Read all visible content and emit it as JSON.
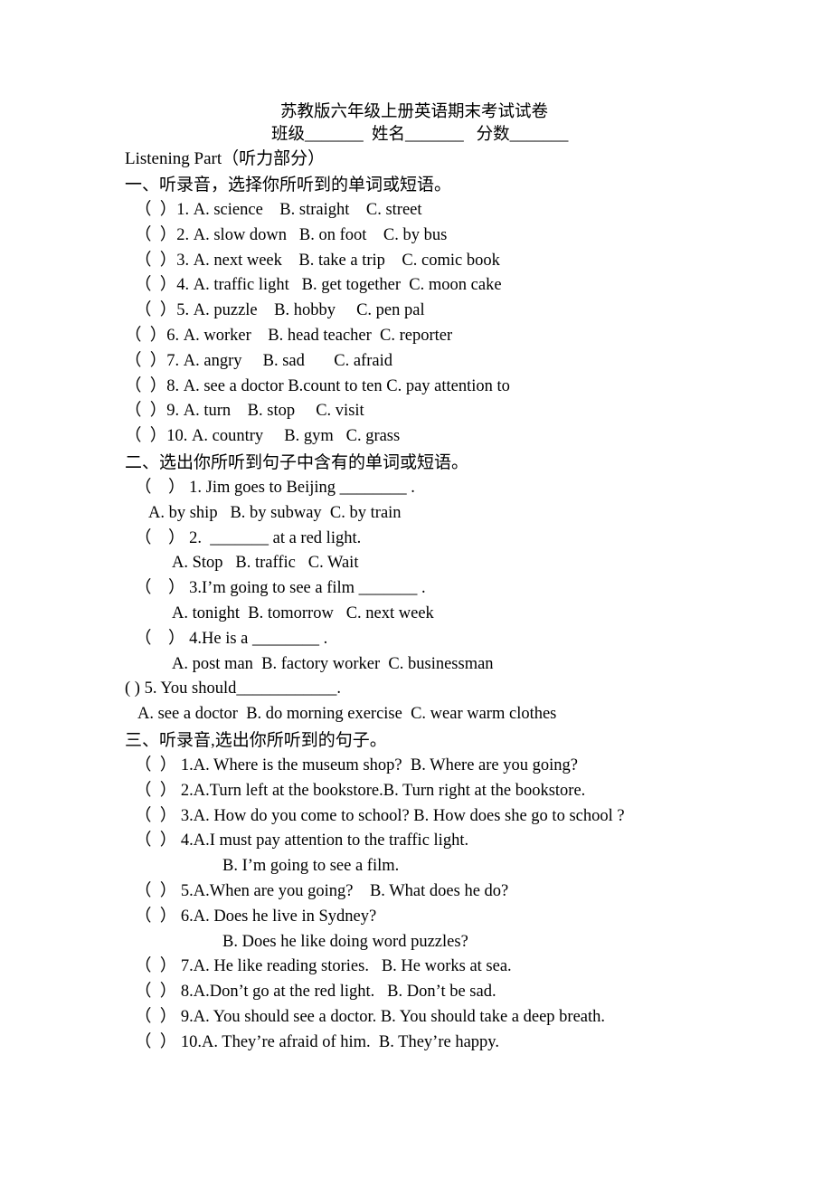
{
  "document": {
    "title": "苏教版六年级上册英语期末考试试卷",
    "id_line": "班级_______  姓名_______   分数_______",
    "part_label": "Listening Part（听力部分）"
  },
  "section_one": {
    "heading": "一、听录音，选择你所听到的单词或短语。",
    "items": [
      "（  ）1. A. science    B. straight    C. street",
      "（  ）2. A. slow down   B. on foot    C. by bus",
      "（  ）3. A. next week    B. take a trip    C. comic book",
      "（  ）4. A. traffic light   B. get together  C. moon cake",
      "（  ）5. A. puzzle    B. hobby     C. pen pal",
      "（  ）6. A. worker    B. head teacher  C. reporter",
      "（  ）7. A. angry     B. sad       C. afraid",
      "（  ）8. A. see a doctor B.count to ten C. pay attention to",
      "（  ）9. A. turn    B. stop     C. visit",
      "（  ）10. A. country     B. gym   C. grass"
    ]
  },
  "section_two": {
    "heading": "二、选出你所听到句子中含有的单词或短语。",
    "lines": [
      {
        "text": "（    ） 1. Jim goes to Beijing ________ .",
        "indent": "ind-c"
      },
      {
        "text": "A. by ship   B. by subway  C. by train",
        "indent": "ind-d"
      },
      {
        "text": "（    ） 2.  _______ at a red light.",
        "indent": "ind-c"
      },
      {
        "text": "A. Stop   B. traffic   C. Wait",
        "indent": "ind-e"
      },
      {
        "text": "（    ） 3.I’m going to see a film _______ .",
        "indent": "ind-c"
      },
      {
        "text": "A. tonight  B. tomorrow   C. next week",
        "indent": "ind-e"
      },
      {
        "text": "（    ） 4.He is a ________ .",
        "indent": "ind-c"
      },
      {
        "text": "A. post man  B. factory worker  C. businessman",
        "indent": "ind-e"
      },
      {
        "text": "( ) 5. You should____________.",
        "indent": "ind-f"
      },
      {
        "text": "A. see a doctor  B. do morning exercise  C. wear warm clothes",
        "indent": "ind-g"
      }
    ]
  },
  "section_three": {
    "heading": "三、听录音,选出你所听到的句子。",
    "lines": [
      {
        "text": "（  ） 1.A. Where is the museum shop?  B. Where are you going?",
        "indent": "ind-h"
      },
      {
        "text": "（  ） 2.A.Turn left at the bookstore.B. Turn right at the bookstore.",
        "indent": "ind-h"
      },
      {
        "text": "（  ） 3.A. How do you come to school? B. How does she go to school ?",
        "indent": "ind-h"
      },
      {
        "text": "（  ） 4.A.I must pay attention to the traffic light.",
        "indent": "ind-h"
      },
      {
        "text": "B. I’m going to see a film.",
        "indent": "ind-i"
      },
      {
        "text": "（  ） 5.A.When are you going?    B. What does he do?",
        "indent": "ind-h"
      },
      {
        "text": "（  ） 6.A. Does he live in Sydney?",
        "indent": "ind-h"
      },
      {
        "text": "B. Does he like doing word puzzles?",
        "indent": "ind-i"
      },
      {
        "text": "（  ） 7.A. He like reading stories.   B. He works at sea.",
        "indent": "ind-h"
      },
      {
        "text": "（  ） 8.A.Don’t go at the red light.   B. Don’t be sad.",
        "indent": "ind-h"
      },
      {
        "text": "（  ） 9.A. You should see a doctor. B. You should take a deep breath.",
        "indent": "ind-h"
      },
      {
        "text": "（  ） 10.A. They’re afraid of him.  B. They’re happy.",
        "indent": "ind-h"
      }
    ]
  }
}
